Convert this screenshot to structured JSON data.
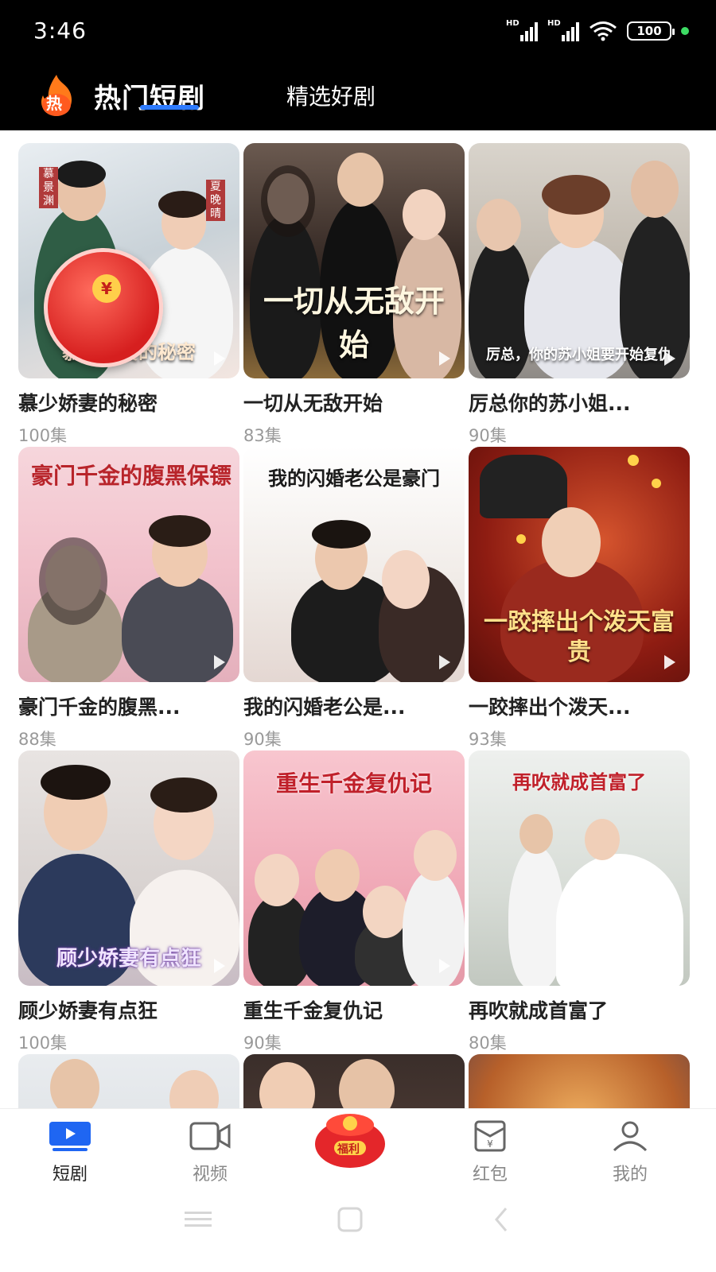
{
  "status": {
    "time": "3:46",
    "battery": "100",
    "sim1": "HD",
    "sim2": "HD"
  },
  "header": {
    "logo_char": "热",
    "tab_hot": "热门短剧",
    "tab_select": "精选好剧"
  },
  "dramas": [
    {
      "title": "慕少娇妻的秘密",
      "episodes": "100集",
      "poster_text": "慕少娇妻的秘密"
    },
    {
      "title": "一切从无敌开始",
      "episodes": "83集",
      "poster_text": "一切从无敌开始"
    },
    {
      "title": "厉总你的苏小姐...",
      "episodes": "90集",
      "poster_text": "厉总，你的苏小姐要开始复仇"
    },
    {
      "title": "豪门千金的腹黑...",
      "episodes": "88集",
      "poster_text": "豪门千金的腹黑保镖"
    },
    {
      "title": "我的闪婚老公是...",
      "episodes": "90集",
      "poster_text": "我的闪婚老公是豪门"
    },
    {
      "title": "一跤摔出个泼天...",
      "episodes": "93集",
      "poster_text": "一跤摔出个泼天富贵"
    },
    {
      "title": "顾少娇妻有点狂",
      "episodes": "100集",
      "poster_text": "顾少娇妻有点狂"
    },
    {
      "title": "重生千金复仇记",
      "episodes": "90集",
      "poster_text": "重生千金复仇记"
    },
    {
      "title": "再吹就成首富了",
      "episodes": "80集",
      "poster_text": "再吹就成首富了"
    }
  ],
  "poster_names": {
    "left": "慕景渊",
    "right": "夏晚晴"
  },
  "redpacket_symbol": "¥",
  "nav": {
    "short_drama": "短剧",
    "video": "视频",
    "welfare": "福利",
    "redpacket": "红包",
    "mine": "我的"
  },
  "colors": {
    "accent": "#2e7bff",
    "header_bg": "#000000",
    "redpacket": "#d61f1f"
  }
}
